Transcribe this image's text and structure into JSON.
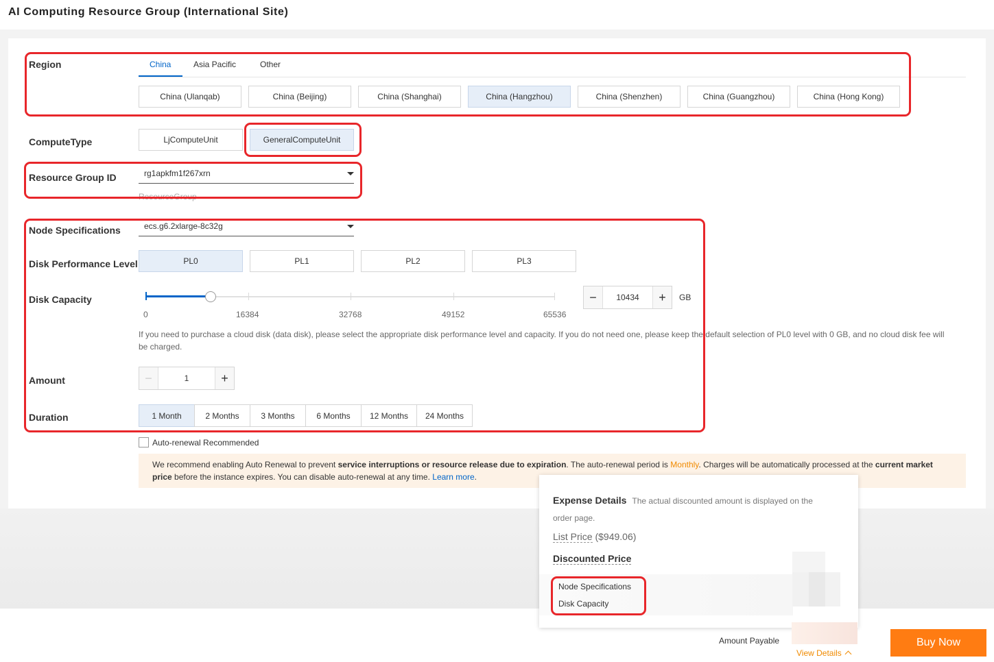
{
  "page_title": "AI Computing Resource Group (International Site)",
  "region": {
    "label": "Region",
    "tabs": [
      "China",
      "Asia Pacific",
      "Other"
    ],
    "active_tab": "China",
    "options": [
      "China (Ulanqab)",
      "China (Beijing)",
      "China (Shanghai)",
      "China (Hangzhou)",
      "China (Shenzhen)",
      "China (Guangzhou)",
      "China (Hong Kong)"
    ],
    "selected": "China (Hangzhou)"
  },
  "compute_type": {
    "label": "ComputeType",
    "options": [
      "LjComputeUnit",
      "GeneralComputeUnit"
    ],
    "selected": "GeneralComputeUnit"
  },
  "resource_group": {
    "label": "Resource Group ID",
    "value": "rg1apkfm1f267xrn",
    "hint": "ResourceGroup"
  },
  "node_spec": {
    "label": "Node Specifications",
    "value": "ecs.g6.2xlarge-8c32g"
  },
  "disk_perf": {
    "label": "Disk Performance Level",
    "options": [
      "PL0",
      "PL1",
      "PL2",
      "PL3"
    ],
    "selected": "PL0"
  },
  "disk_capacity": {
    "label": "Disk Capacity",
    "slider_ticks": [
      "0",
      "16384",
      "32768",
      "49152",
      "65536"
    ],
    "slider_max": 65536,
    "value": "10434",
    "unit": "GB",
    "note": "If you need to purchase a cloud disk (data disk), please select the appropriate disk performance level and capacity. If you do not need one, please keep the default selection of PL0 level with 0 GB, and no cloud disk fee will be charged."
  },
  "amount": {
    "label": "Amount",
    "value": "1",
    "minus": "−",
    "plus": "+"
  },
  "duration": {
    "label": "Duration",
    "options": [
      "1 Month",
      "2 Months",
      "3 Months",
      "6 Months",
      "12 Months",
      "24 Months"
    ],
    "selected": "1 Month"
  },
  "auto_renew": {
    "label": "Auto-renewal Recommended",
    "checked": false
  },
  "banner": {
    "t1": "We recommend enabling Auto Renewal to prevent ",
    "b1": "service interruptions or resource release due to expiration",
    "t2": ". The auto-renewal period is ",
    "period": "Monthly",
    "t3": ". Charges will be automatically processed at the ",
    "b2": "current market price",
    "t4": " before the instance expires. You can disable auto-renewal at any time. ",
    "link": "Learn more",
    "t5": "."
  },
  "expense": {
    "title": "Expense Details",
    "desc": "The actual discounted amount is displayed on the order page.",
    "list_price_label": "List Price",
    "list_price_value": " ($949.06)",
    "discounted_label": "Discounted Price",
    "items": [
      "Node Specifications",
      "Disk Capacity"
    ]
  },
  "footer": {
    "amount_payable": "Amount Payable",
    "view_details": "View Details",
    "buy_now": "Buy Now"
  },
  "colors": {
    "accent": "#0064c8",
    "highlight": "#e8262a",
    "buy": "#ff7c12",
    "warning_text": "#f08a00"
  }
}
